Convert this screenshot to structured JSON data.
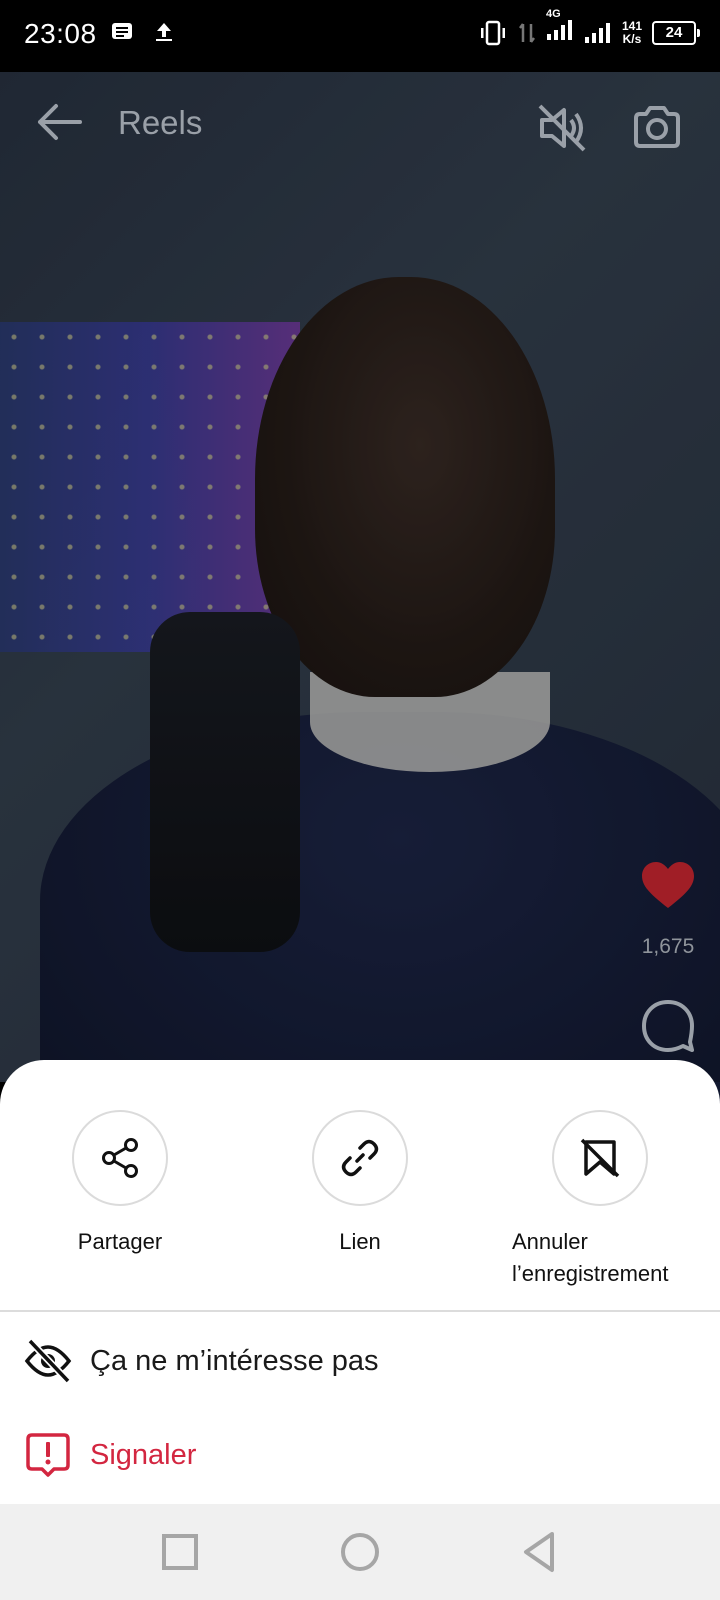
{
  "status_bar": {
    "time": "23:08",
    "network_type": "4G",
    "net_speed_value": "141",
    "net_speed_unit": "K/s",
    "battery_level": "24"
  },
  "header": {
    "title": "Reels"
  },
  "reel": {
    "like_count": "1,675",
    "liked": true,
    "like_color": "#d0243a"
  },
  "sheet": {
    "actions": [
      {
        "label": "Partager",
        "icon": "share-icon"
      },
      {
        "label": "Lien",
        "icon": "link-icon"
      },
      {
        "label": "Annuler l’enregistrement",
        "icon": "unsave-bookmark-icon"
      }
    ],
    "menu": [
      {
        "label": "Ça ne m’intéresse pas",
        "icon": "eye-off-icon"
      },
      {
        "label": "Signaler",
        "icon": "report-icon",
        "color": "#d32640"
      }
    ]
  },
  "nav_bar": {
    "buttons": [
      "recent-apps-icon",
      "home-icon",
      "back-icon"
    ]
  }
}
